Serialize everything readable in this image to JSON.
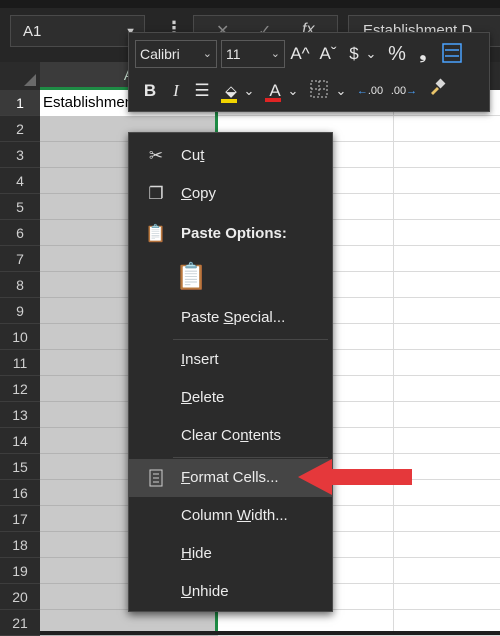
{
  "formula_bar": {
    "name_box": "A1",
    "cancel_symbol": "✕",
    "enter_symbol": "✓",
    "fx_symbol": "fx",
    "content": "Establishment D"
  },
  "grid": {
    "column_a_header": "A",
    "rows": [
      "1",
      "2",
      "3",
      "4",
      "5",
      "6",
      "7",
      "8",
      "9",
      "10",
      "11",
      "12",
      "13",
      "14",
      "15",
      "16",
      "17",
      "18",
      "19",
      "20",
      "21"
    ],
    "cell_a1": "Establishment"
  },
  "mini_toolbar": {
    "font": "Calibri",
    "size": "11",
    "grow_font": "A^",
    "shrink_font": "Aˇ",
    "currency": "$",
    "percent": "%",
    "comma": "❟",
    "bold": "B",
    "italic": "I",
    "highlight_letter": "A",
    "increase_decimal": ".00",
    "decrease_decimal": ".00"
  },
  "context_menu": {
    "cut": {
      "pre": "Cu",
      "key": "t",
      "post": ""
    },
    "copy": {
      "pre": "",
      "key": "C",
      "post": "opy"
    },
    "paste_options": "Paste Options:",
    "paste_special": {
      "pre": "Paste ",
      "key": "S",
      "post": "pecial..."
    },
    "insert": {
      "pre": "",
      "key": "I",
      "post": "nsert"
    },
    "delete": {
      "pre": "",
      "key": "D",
      "post": "elete"
    },
    "clear_contents": {
      "pre": "Clear Co",
      "key": "n",
      "post": "tents"
    },
    "format_cells": {
      "pre": "",
      "key": "F",
      "post": "ormat Cells..."
    },
    "column_width": {
      "pre": "Column ",
      "key": "W",
      "post": "idth..."
    },
    "hide": {
      "pre": "",
      "key": "H",
      "post": "ide"
    },
    "unhide": {
      "pre": "",
      "key": "U",
      "post": "nhide"
    }
  },
  "colors": {
    "accent_green": "#1e8c45",
    "arrow_red": "#e5383b",
    "menu_bg": "#2b2b2b"
  }
}
